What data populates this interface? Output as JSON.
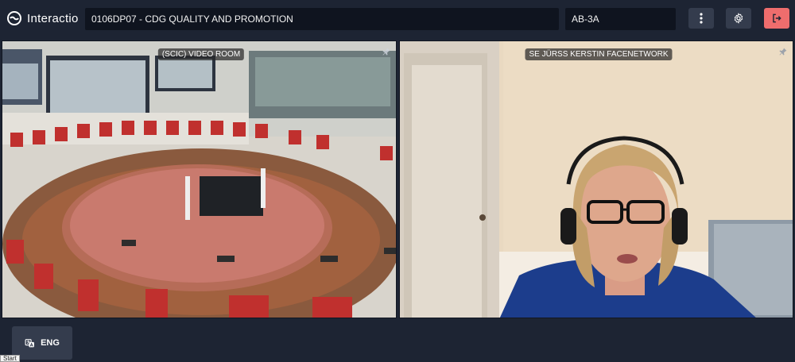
{
  "app": {
    "name": "Interactio"
  },
  "header": {
    "session_title": "0106DP07 - CDG QUALITY AND PROMOTION",
    "room_code": "AB-3A"
  },
  "icons": {
    "more": "more-vertical-icon",
    "settings": "gear-icon",
    "exit": "exit-icon",
    "pin": "pin-icon",
    "translate": "translate-icon"
  },
  "videos": [
    {
      "label": "(SCIC) VIDEO ROOM"
    },
    {
      "label": "SE JÜRSS KERSTIN FACENETWORK"
    }
  ],
  "footer": {
    "language_label": "ENG"
  },
  "tooltip": {
    "text": "Start"
  },
  "colors": {
    "background": "#1d2433",
    "field": "#0f141f",
    "button": "#343c4d",
    "exit_button": "#ee6d6d"
  }
}
